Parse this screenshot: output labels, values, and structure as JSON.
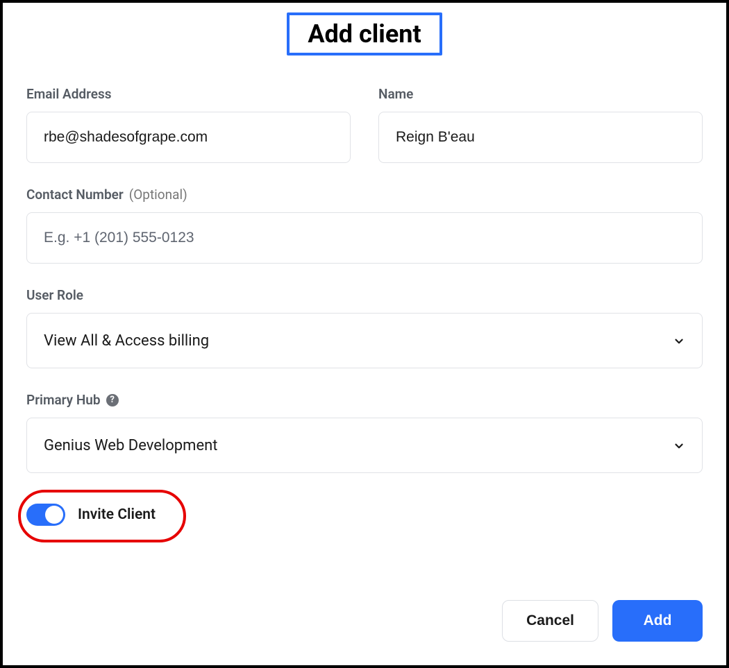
{
  "header": {
    "title": "Add client"
  },
  "fields": {
    "email": {
      "label": "Email Address",
      "value": "rbe@shadesofgrape.com"
    },
    "name": {
      "label": "Name",
      "value": "Reign B'eau"
    },
    "contact": {
      "label": "Contact Number",
      "optional": "(Optional)",
      "placeholder": "E.g. +1 (201) 555-0123",
      "value": ""
    },
    "role": {
      "label": "User Role",
      "value": "View All & Access billing"
    },
    "hub": {
      "label": "Primary Hub",
      "value": "Genius Web Development"
    }
  },
  "toggle": {
    "label": "Invite Client",
    "on": true
  },
  "buttons": {
    "cancel": "Cancel",
    "add": "Add"
  },
  "icons": {
    "help": "?"
  }
}
